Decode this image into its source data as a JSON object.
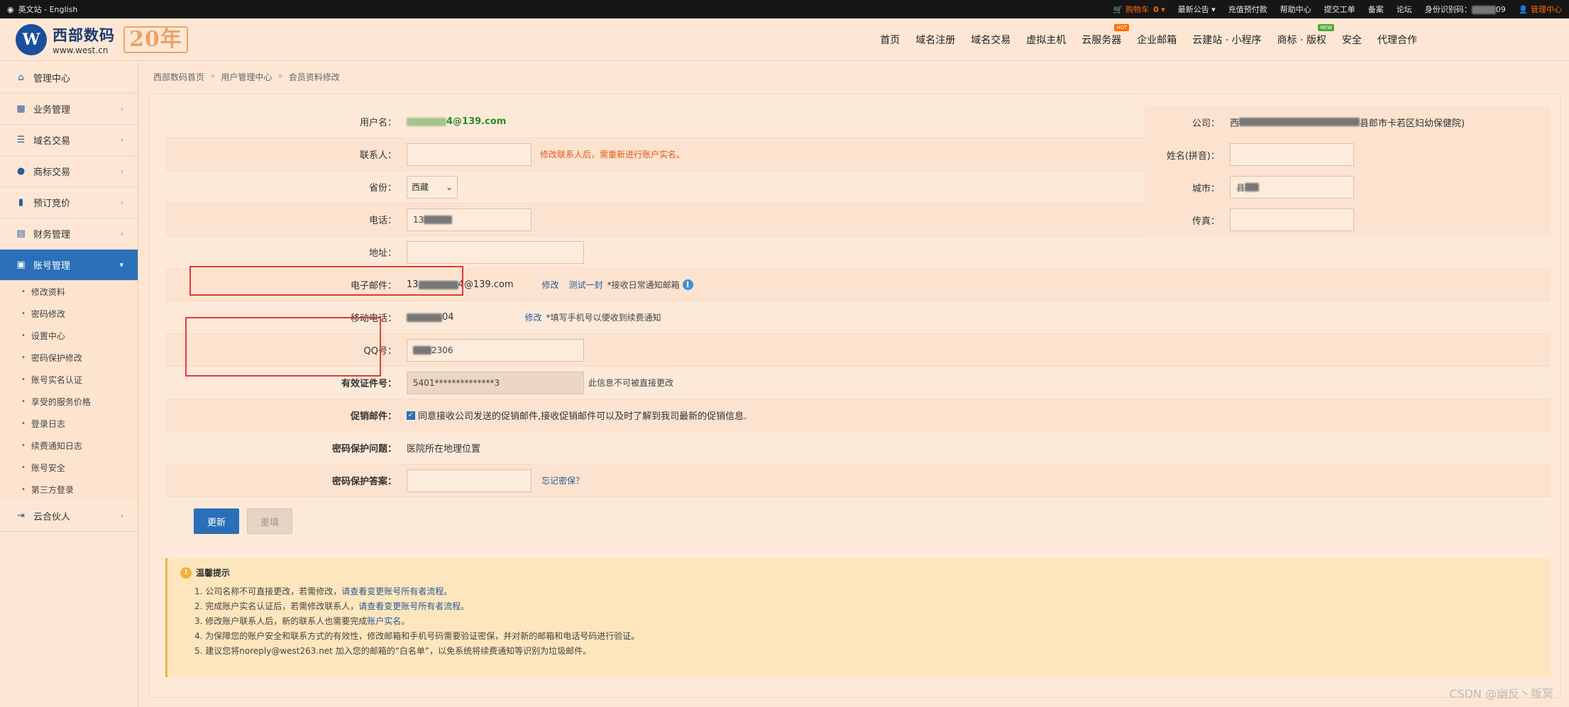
{
  "topbar": {
    "lang": "英文站 - English",
    "cart_label": "购物车",
    "cart_count": "0",
    "links": [
      "最新公告 ▾",
      "充值预付款",
      "帮助中心",
      "提交工单",
      "备案",
      "论坛"
    ],
    "id_label": "身份识别码：",
    "id_tail": "09",
    "manage": "管理中心"
  },
  "header": {
    "logo_cn": "西部数码",
    "logo_url": "www.west.cn",
    "logo_badge": "20年",
    "nav": [
      "首页",
      "域名注册",
      "域名交易",
      "虚拟主机",
      "云服务器",
      "企业邮箱",
      "云建站 · 小程序",
      "商标 · 版权",
      "安全",
      "代理合作"
    ],
    "hot": "HOT",
    "new": "NEW"
  },
  "sidebar": {
    "items": [
      {
        "label": "管理中心",
        "icon": "home-icon"
      },
      {
        "label": "业务管理",
        "icon": "grid-icon"
      },
      {
        "label": "域名交易",
        "icon": "list-icon"
      },
      {
        "label": "商标交易",
        "icon": "circle-icon"
      },
      {
        "label": "预订竞价",
        "icon": "bars-icon"
      },
      {
        "label": "财务管理",
        "icon": "doc-icon"
      },
      {
        "label": "账号管理",
        "icon": "card-icon"
      },
      {
        "label": "云合伙人",
        "icon": "exit-icon"
      }
    ],
    "sub": [
      "修改资料",
      "密码修改",
      "设置中心",
      "密码保护修改",
      "账号实名认证",
      "享受的服务价格",
      "登录日志",
      "续费通知日志",
      "账号安全",
      "第三方登录"
    ]
  },
  "breadcrumb": [
    "西部数码首页",
    "用户管理中心",
    "会员资料修改"
  ],
  "form": {
    "username_label": "用户名：",
    "username_value": "4@139.com",
    "contact_label": "联系人：",
    "contact_hint": "修改联系人后，需重新进行账户实名。",
    "province_label": "省份：",
    "province_value": "西藏",
    "phone_label": "电话：",
    "phone_value": "13",
    "address_label": "地址：",
    "email_label": "电子邮件：",
    "email_value_a": "13",
    "email_value_b": "4@139.com",
    "email_modify": "修改",
    "email_test": "测试一封",
    "email_hint": "*接收日常通知邮箱",
    "mobile_label": "移动电话：",
    "mobile_value": "04",
    "mobile_modify": "修改",
    "mobile_hint": "*填写手机号以便收到续费通知",
    "qq_label": "QQ号：",
    "qq_value": "2306",
    "id_label": "有效证件号：",
    "id_value": "5401**************3",
    "id_hint": "此信息不可被直接更改",
    "promo_label": "促销邮件：",
    "promo_text": "同意接收公司发送的促销邮件,接收促销邮件可以及时了解到我司最新的促销信息.",
    "question_label": "密码保护问题：",
    "question_value": "医院所在地理位置",
    "answer_label": "密码保护答案：",
    "answer_forgot": "忘记密保？",
    "submit": "更新",
    "reset": "重填"
  },
  "right": {
    "company_label": "公司：",
    "company_value_a": "西",
    "company_value_b": "县郎市卡若区妇幼保健院)",
    "pinyin_label": "姓名(拼音)：",
    "city_label": "城市：",
    "city_value": "县",
    "fax_label": "传真："
  },
  "tips": {
    "title": "温馨提示",
    "items": [
      {
        "text": "1. 公司名称不可直接更改，若需修改，",
        "link": "请查看变更账号所有者流程。"
      },
      {
        "text": "2. 完成账户实名认证后，若需修改联系人，",
        "link": "请查看变更账号所有者流程。"
      },
      {
        "text": "3. 修改账户联系人后，新的联系人也需要完成",
        "link": "账户实名。"
      },
      {
        "text": "4. 为保障您的账户安全和联系方式的有效性，修改邮箱和手机号码需要验证密保，并对新的邮箱和电话号码进行验证。",
        "link": ""
      },
      {
        "text": "5. 建议您将noreply@west263.net 加入您的邮箱的“白名单”，以免系统将续费通知等识别为垃圾邮件。",
        "link": ""
      }
    ]
  },
  "watermark": "CSDN @幽反丶叛冥",
  "colors": {
    "accent": "#2a6fb7",
    "warning": "#e35b1a",
    "highlight_box": "#e23a3a",
    "background": "#fde7d4"
  }
}
